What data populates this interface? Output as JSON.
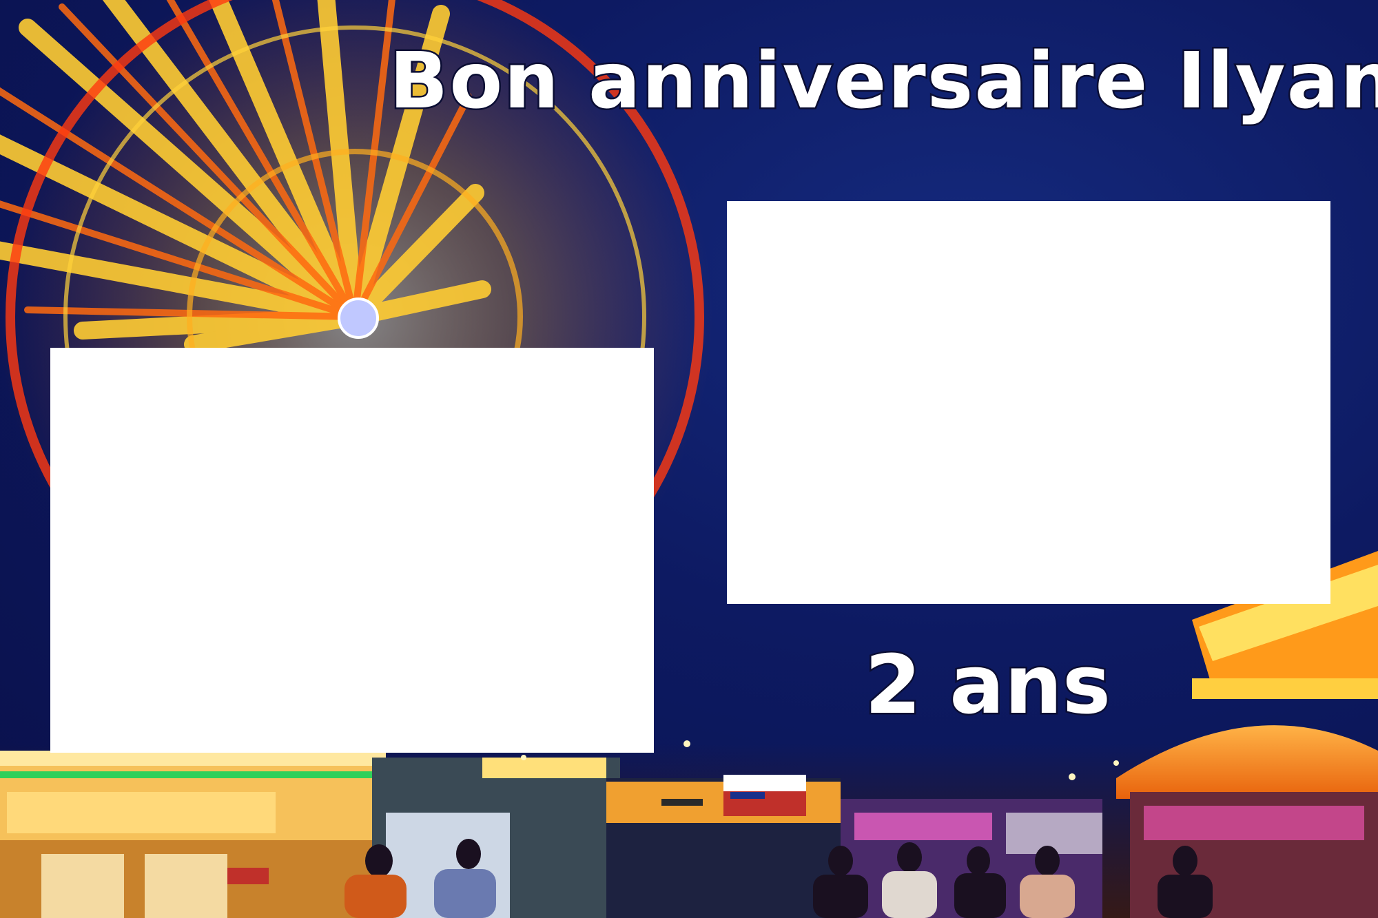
{
  "card": {
    "title": "Bon anniversaire Ilyana",
    "age": "2 ans"
  },
  "colors": {
    "sky": "#0d1a62",
    "text": "#ffffff",
    "text_outline": "#0a0d33",
    "lights_yellow": "#ffd23a",
    "lights_orange": "#ff7a12"
  }
}
